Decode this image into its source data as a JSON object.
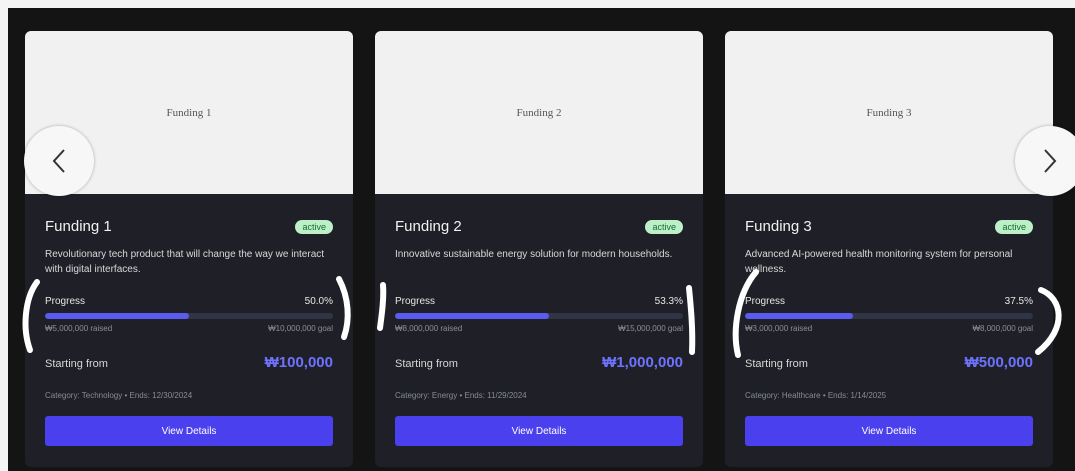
{
  "carousel": {
    "cards": [
      {
        "image_label": "Funding 1",
        "title": "Funding 1",
        "status": "active",
        "description": "Revolutionary tech product that will change the way we interact with digital interfaces.",
        "progress_label": "Progress",
        "progress_percent_text": "50.0%",
        "progress_fraction": 0.5,
        "raised": "₩5,000,000 raised",
        "goal": "₩10,000,000 goal",
        "starting_label": "Starting from",
        "price": "₩100,000",
        "meta": "Category: Technology • Ends: 12/30/2024",
        "button_label": "View Details"
      },
      {
        "image_label": "Funding 2",
        "title": "Funding 2",
        "status": "active",
        "description": "Innovative sustainable energy solution for modern households.",
        "progress_label": "Progress",
        "progress_percent_text": "53.3%",
        "progress_fraction": 0.533,
        "raised": "₩8,000,000 raised",
        "goal": "₩15,000,000 goal",
        "starting_label": "Starting from",
        "price": "₩1,000,000",
        "meta": "Category: Energy • Ends: 11/29/2024",
        "button_label": "View Details"
      },
      {
        "image_label": "Funding 3",
        "title": "Funding 3",
        "status": "active",
        "description": "Advanced AI-powered health monitoring system for personal wellness.",
        "progress_label": "Progress",
        "progress_percent_text": "37.5%",
        "progress_fraction": 0.375,
        "raised": "₩3,000,000 raised",
        "goal": "₩8,000,000 goal",
        "starting_label": "Starting from",
        "price": "₩500,000",
        "meta": "Category: Healthcare • Ends: 1/14/2025",
        "button_label": "View Details"
      }
    ],
    "prev_icon": "chevron-left-icon",
    "next_icon": "chevron-right-icon"
  },
  "colors": {
    "background": "#141414",
    "card": "#1f2027",
    "accent": "#4b40ee",
    "progress_fill": "#5a5cf0",
    "price": "#6e72ff",
    "badge_bg": "#bdf0c8"
  }
}
